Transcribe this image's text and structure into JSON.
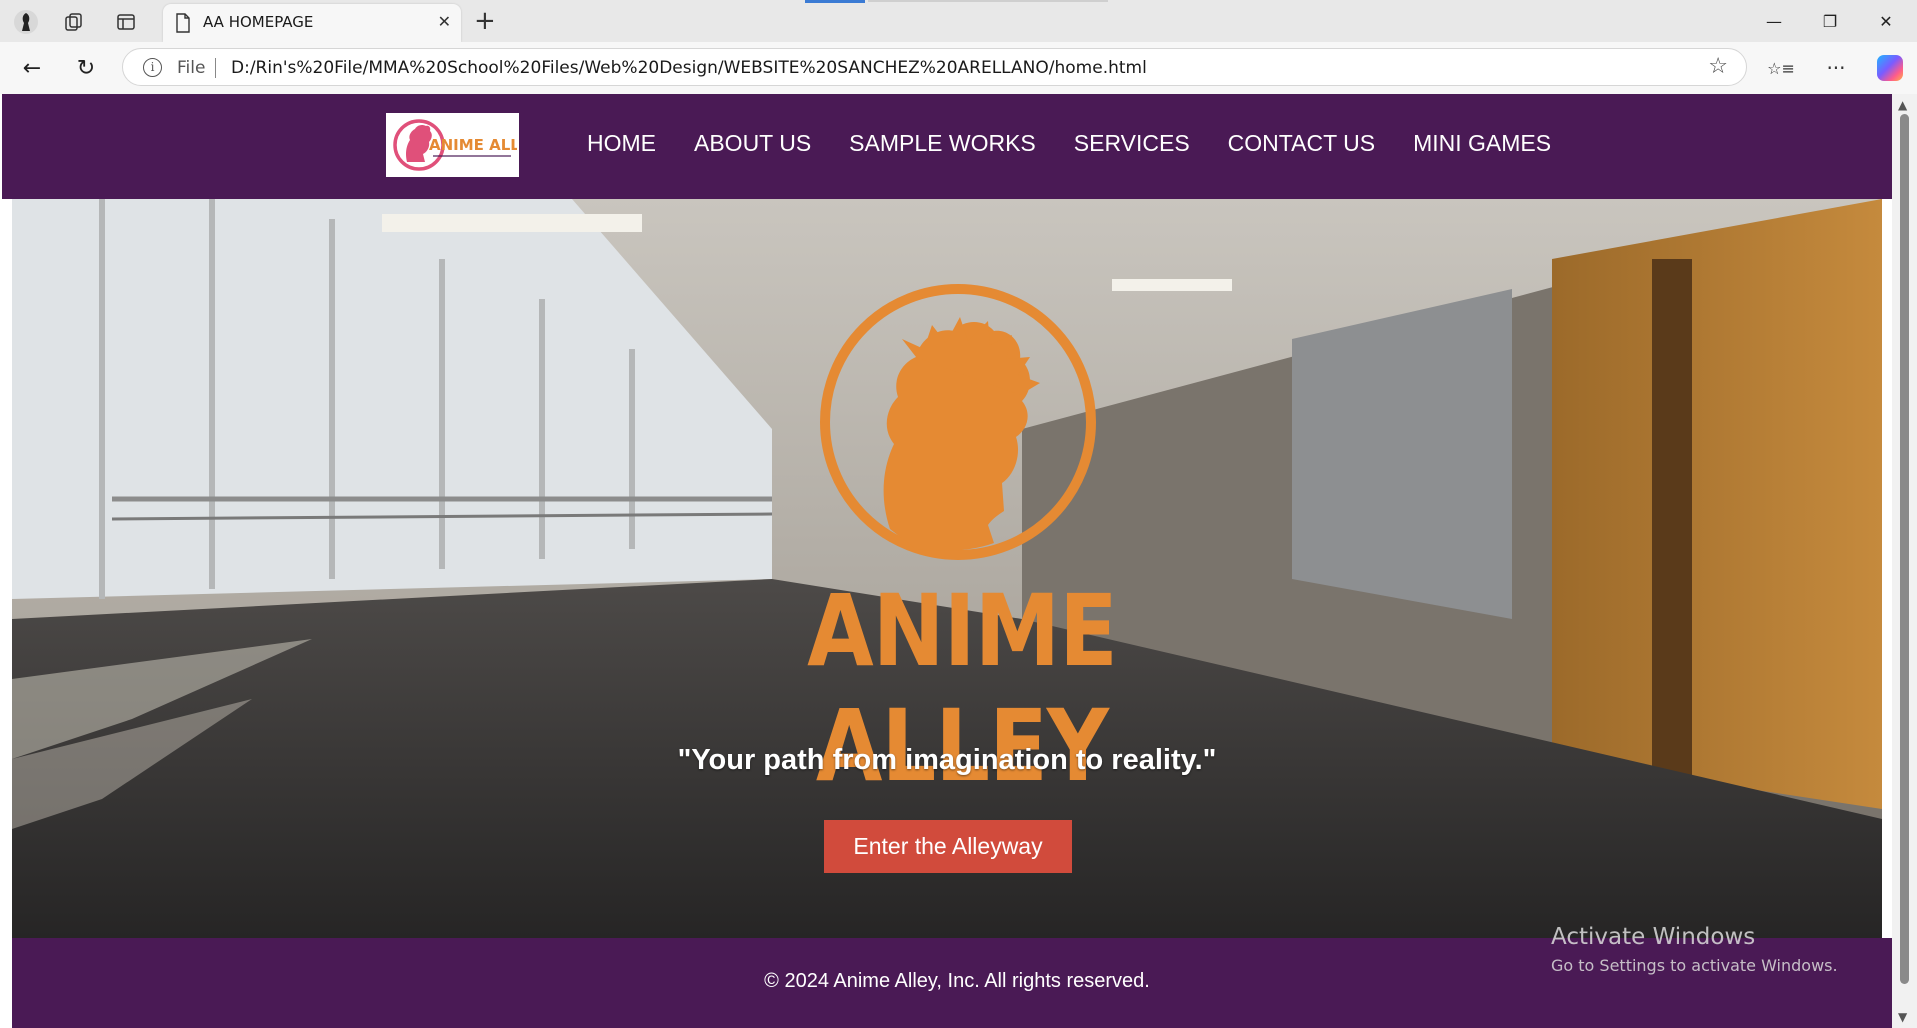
{
  "browser": {
    "tab_title": "AA HOMEPAGE",
    "tab_close": "✕",
    "new_tab": "+",
    "address": {
      "scheme_label": "File",
      "url": "D:/Rin's%20File/MMA%20School%20Files/Web%20Design/WEBSITE%20SANCHEZ%20ARELLANO/home.html"
    },
    "icons": {
      "back": "←",
      "reload": "↻",
      "info": "i",
      "favorite": "☆",
      "favorites_list": "☆≡",
      "more": "···",
      "minimize": "—",
      "restore": "❐",
      "close": "✕"
    }
  },
  "site": {
    "logo_text": "ANIME ALLEY",
    "nav": [
      "HOME",
      "ABOUT US",
      "SAMPLE WORKS",
      "SERVICES",
      "CONTACT US",
      "MINI GAMES"
    ],
    "hero": {
      "brand": "ANIME ALLEY",
      "tagline": "\"Your path from imagination to reality.\"",
      "cta": "Enter the Alleyway"
    },
    "footer": "© 2024 Anime Alley, Inc. All rights reserved."
  },
  "watermark": {
    "line1": "Activate Windows",
    "line2": "Go to Settings to activate Windows."
  },
  "colors": {
    "header_bg": "#4a1a55",
    "cta_bg": "#d14b3c",
    "logo_orange": "#e58a33",
    "logo_pink": "#e0507a"
  }
}
